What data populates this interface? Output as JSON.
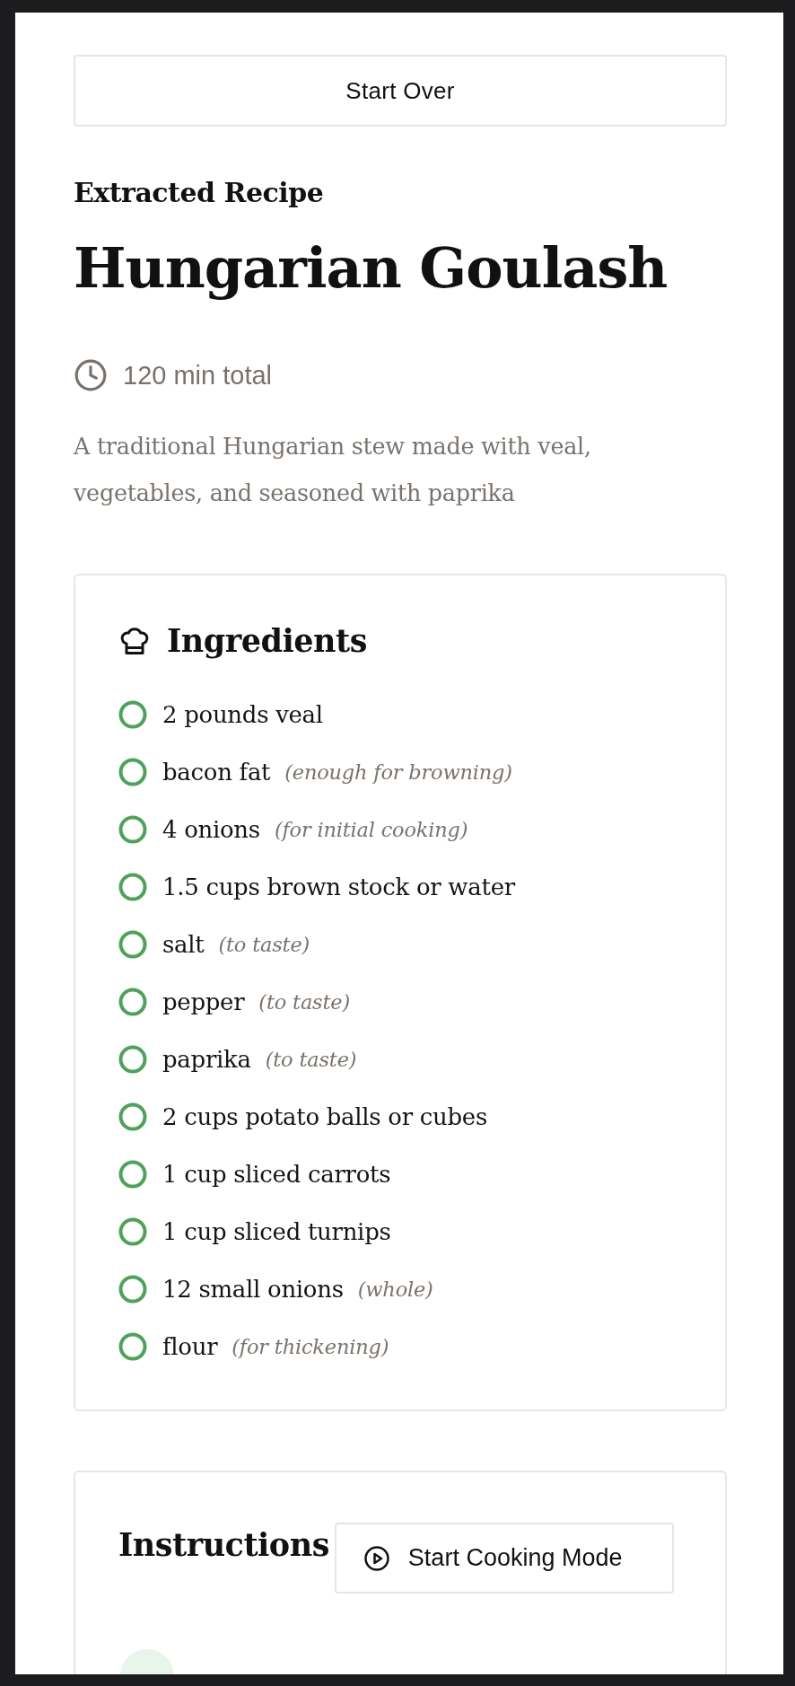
{
  "start_over_button": {
    "label": "Start Over"
  },
  "eyebrow": "Extracted Recipe",
  "title": "Hungarian Goulash",
  "total_time": "120 min total",
  "description": "A traditional Hungarian stew made with veal, vegetables, and seasoned with paprika",
  "ingredients": {
    "heading": "Ingredients",
    "items": [
      {
        "text": "2 pounds veal",
        "checked": false
      },
      {
        "text": "bacon fat",
        "note": "(enough for browning)",
        "checked": false
      },
      {
        "text": "4 onions",
        "note": "(for initial cooking)",
        "checked": false
      },
      {
        "text": "1.5 cups brown stock or water",
        "checked": false
      },
      {
        "text": "salt",
        "note": "(to taste)",
        "checked": false
      },
      {
        "text": "pepper",
        "note": "(to taste)",
        "checked": false
      },
      {
        "text": "paprika",
        "note": "(to taste)",
        "checked": false
      },
      {
        "text": "2 cups potato balls or cubes",
        "checked": false
      },
      {
        "text": "1 cup sliced carrots",
        "checked": false
      },
      {
        "text": "1 cup sliced turnips",
        "checked": false
      },
      {
        "text": "12 small onions",
        "note": "(whole)",
        "checked": false
      },
      {
        "text": "flour",
        "note": "(for thickening)",
        "checked": false
      }
    ]
  },
  "instructions": {
    "heading": "Instructions",
    "cooking_mode_button": {
      "label": "Start Cooking Mode"
    }
  }
}
